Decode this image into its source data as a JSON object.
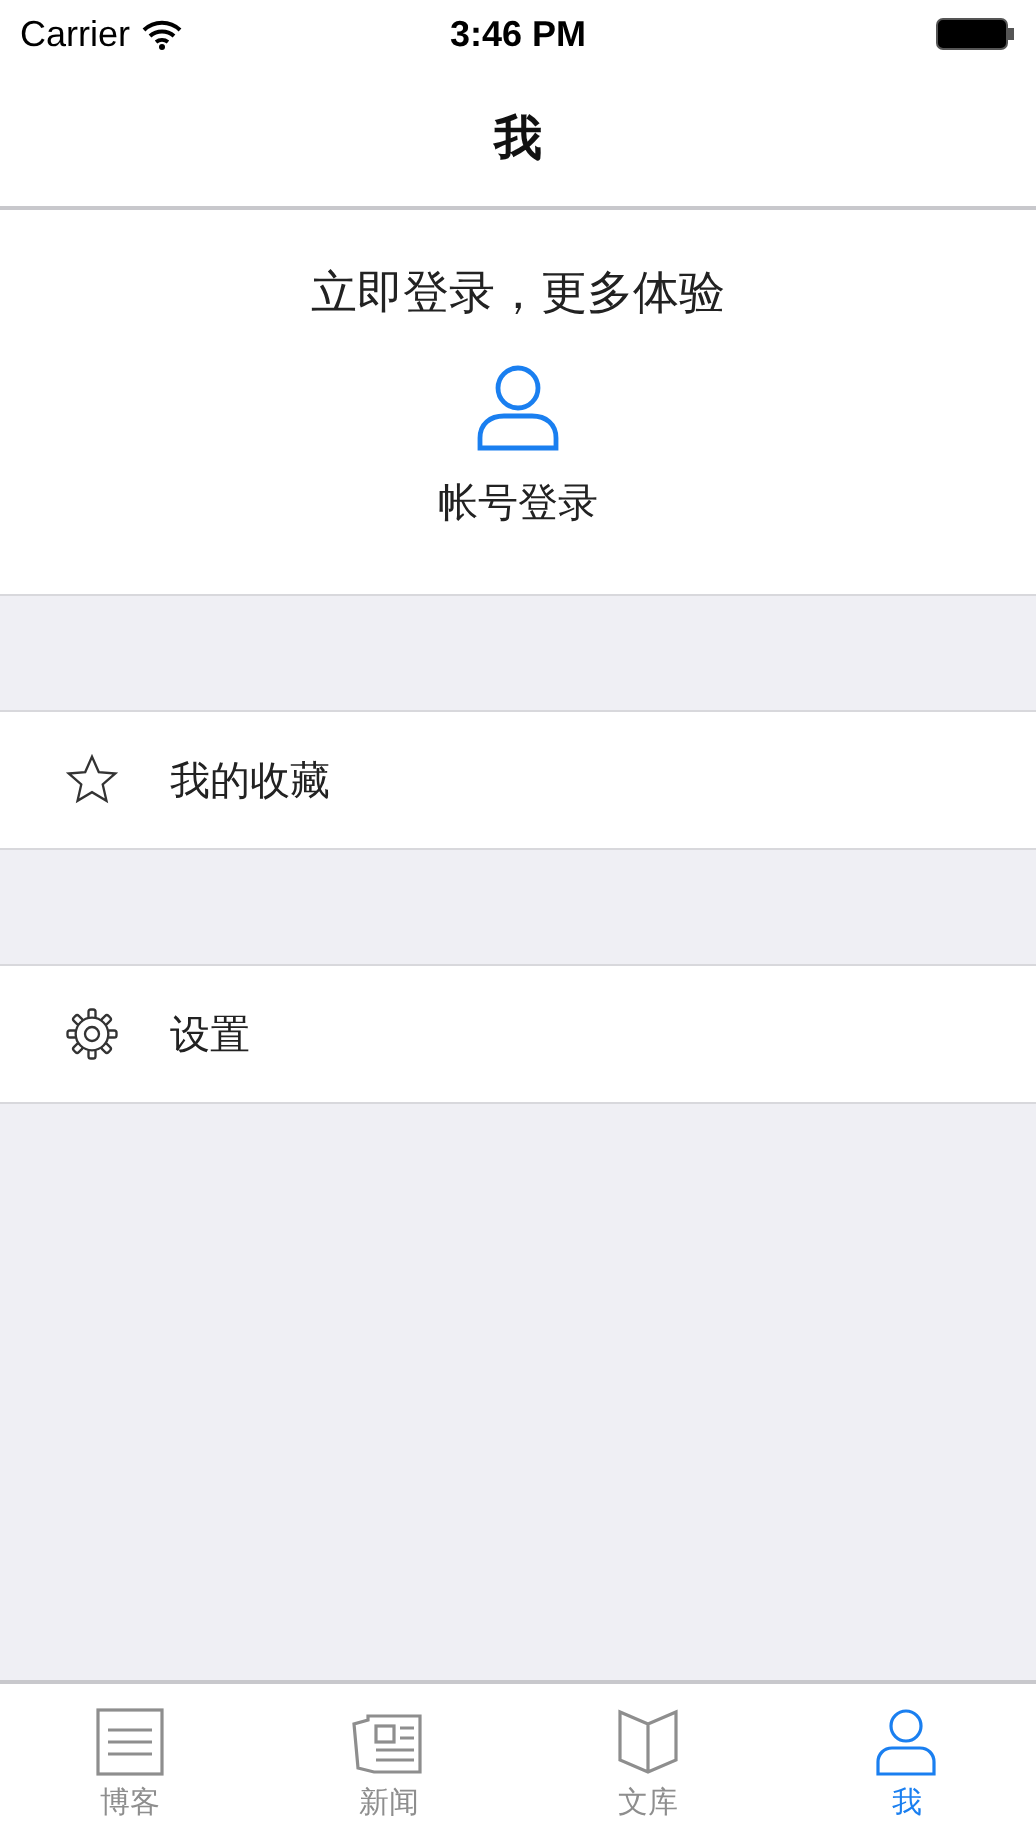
{
  "status_bar": {
    "carrier": "Carrier",
    "time": "3:46 PM"
  },
  "nav": {
    "title": "我"
  },
  "login": {
    "headline": "立即登录，更多体验",
    "action": "帐号登录"
  },
  "menu": [
    {
      "kind": "star",
      "label": "我的收藏"
    },
    {
      "kind": "gear",
      "label": "设置"
    }
  ],
  "tabs": [
    {
      "kind": "list",
      "label": "博客",
      "selected": false
    },
    {
      "kind": "news",
      "label": "新闻",
      "selected": false
    },
    {
      "kind": "book",
      "label": "文库",
      "selected": false
    },
    {
      "kind": "person",
      "label": "我",
      "selected": true
    }
  ]
}
